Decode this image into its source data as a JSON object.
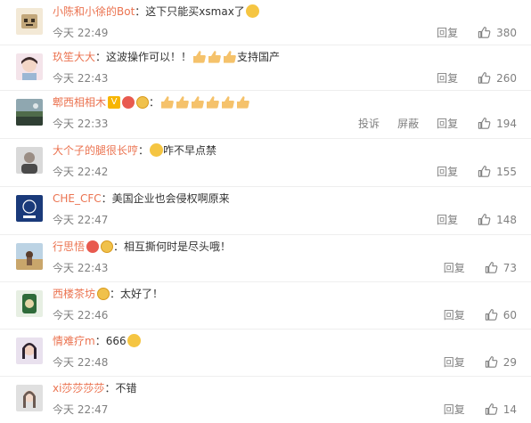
{
  "comments": [
    {
      "user": "小陈和小徐的Bot",
      "text": "这下只能买xsmax了",
      "time": "今天 22:49",
      "actions": [
        "回复"
      ],
      "likes": "380",
      "emoji": [
        "face"
      ]
    },
    {
      "user": "玖笙大大",
      "text": "这波操作可以！！",
      "text_after": "支持国产",
      "time": "今天 22:43",
      "actions": [
        "回复"
      ],
      "likes": "260",
      "thumbs": 3
    },
    {
      "user": "郫西相相木",
      "text": "",
      "time": "今天 22:33",
      "actions": [
        "投诉",
        "屏蔽",
        "回复"
      ],
      "likes": "194",
      "thumbs": 6,
      "badges": [
        "v",
        "vip",
        "gold"
      ]
    },
    {
      "user": "大个子的腿很长哼",
      "text": "咋不早点禁",
      "time": "今天 22:42",
      "actions": [
        "回复"
      ],
      "likes": "155",
      "emoji": [
        "face"
      ]
    },
    {
      "user": "CHE_CFC",
      "text": "美国企业也会侵权啊原来",
      "time": "今天 22:47",
      "actions": [
        "回复"
      ],
      "likes": "148"
    },
    {
      "user": "行思悟",
      "text": "相互撕何时是尽头哦！",
      "time": "今天 22:43",
      "actions": [
        "回复"
      ],
      "likes": "73",
      "badges": [
        "vip",
        "gold"
      ]
    },
    {
      "user": "西楼茶坊",
      "text": "太好了！",
      "time": "今天 22:46",
      "actions": [
        "回复"
      ],
      "likes": "60",
      "badges": [
        "gold"
      ]
    },
    {
      "user": "情难疗m",
      "text": "666",
      "time": "今天 22:48",
      "actions": [
        "回复"
      ],
      "likes": "29",
      "emoji": [
        "face"
      ]
    },
    {
      "user": "xi莎莎莎莎",
      "text": "不错",
      "time": "今天 22:47",
      "actions": [
        "回复"
      ],
      "likes": "14"
    }
  ],
  "colors": {
    "username": "#eb7350",
    "meta": "#808080",
    "divider": "#eeeeee"
  },
  "icons": {
    "like": "thumbs-up-outline-icon",
    "emoji": "emoji-face-icon",
    "thumb_emoji": "thumbs-up-emoji-icon"
  }
}
